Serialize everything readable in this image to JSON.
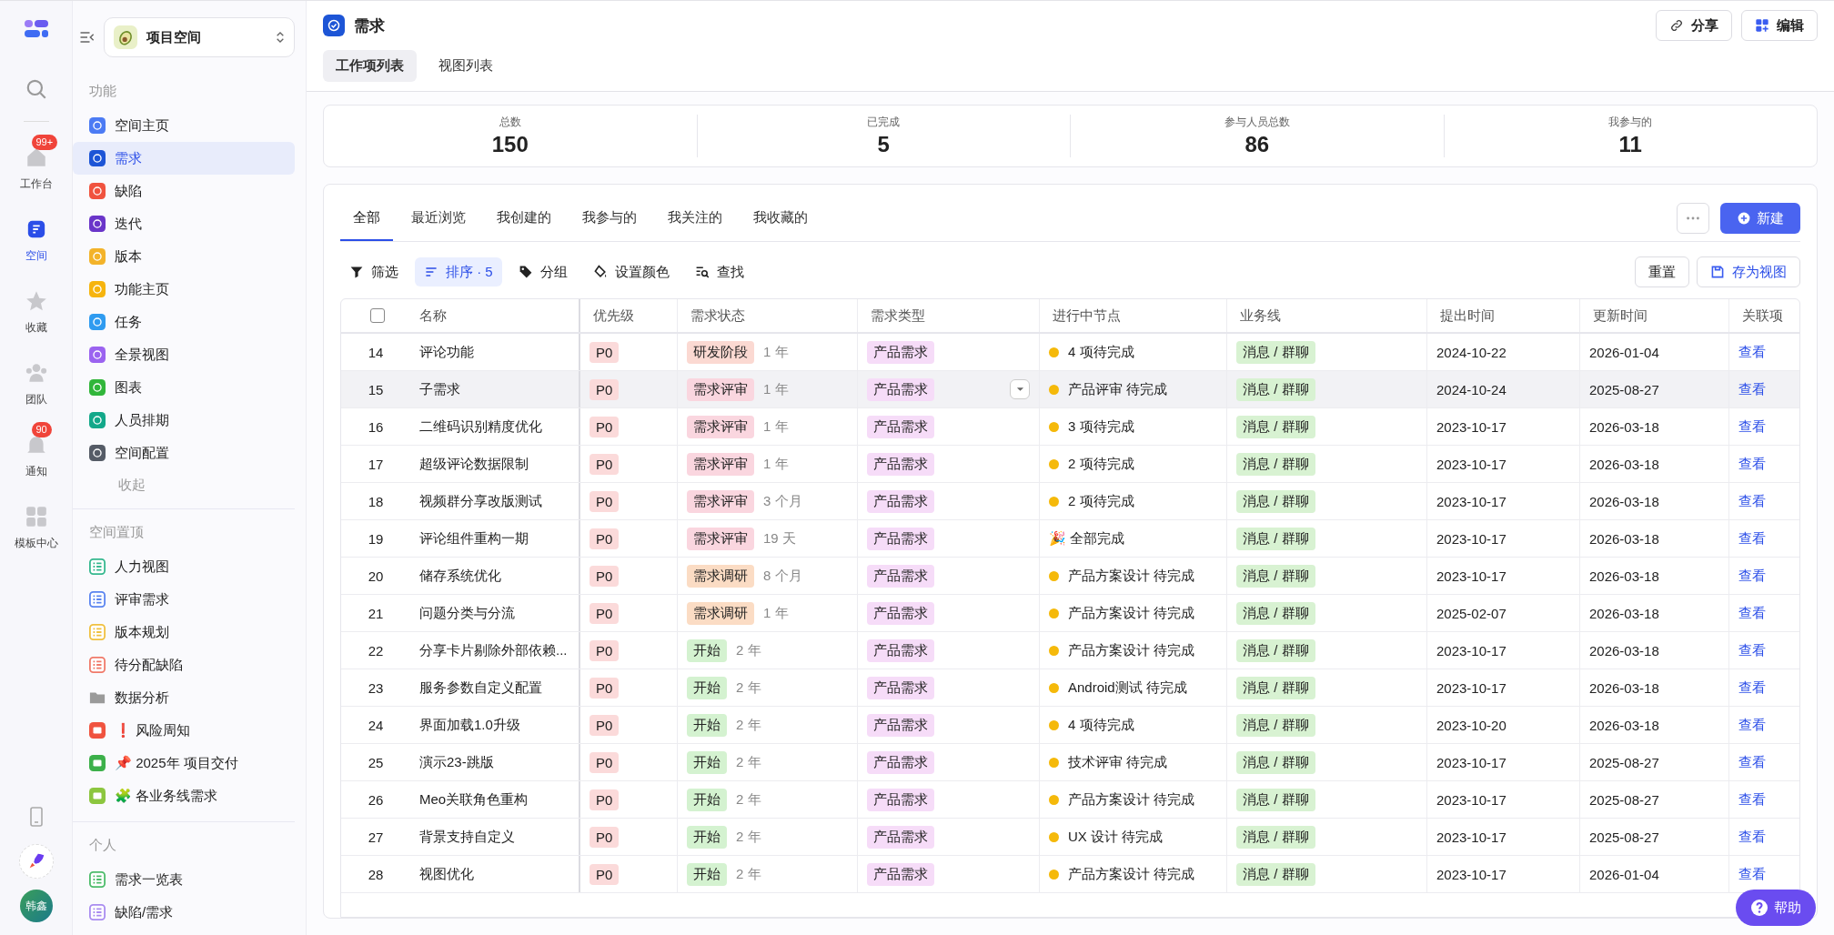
{
  "rail": {
    "items": [
      {
        "label": "工作台",
        "kind": "home",
        "badge": "99+",
        "selected": false
      },
      {
        "label": "空间",
        "kind": "space",
        "selected": true
      },
      {
        "label": "收藏",
        "kind": "star",
        "selected": false
      },
      {
        "label": "团队",
        "kind": "team",
        "selected": false
      },
      {
        "label": "通知",
        "kind": "bell",
        "badge": "90",
        "selected": false
      },
      {
        "label": "模板中心",
        "kind": "grid",
        "selected": false
      }
    ],
    "avatar": "韩鑫"
  },
  "sidebar": {
    "space": "项目空间",
    "sections": [
      {
        "title": "功能",
        "items": [
          {
            "label": "空间主页",
            "color": "#4c7bf4",
            "selected": false
          },
          {
            "label": "需求",
            "color": "#1d55d6",
            "selected": true
          },
          {
            "label": "缺陷",
            "color": "#f0533f",
            "selected": false
          },
          {
            "label": "迭代",
            "color": "#6a35c9",
            "selected": false
          },
          {
            "label": "版本",
            "color": "#f3b32a",
            "selected": false
          },
          {
            "label": "功能主页",
            "color": "#f6b40e",
            "selected": false
          },
          {
            "label": "任务",
            "color": "#2f9bf0",
            "selected": false
          },
          {
            "label": "全景视图",
            "color": "#9b63f0",
            "selected": false
          },
          {
            "label": "图表",
            "color": "#31b63a",
            "selected": false
          },
          {
            "label": "人员排期",
            "color": "#13a88a",
            "selected": false
          },
          {
            "label": "空间配置",
            "color": "#555b66",
            "selected": false
          }
        ],
        "more": "收起"
      },
      {
        "title": "空间置顶",
        "items": [
          {
            "label": "人力视图",
            "kind": "list",
            "color": "#35b88f",
            "selected": false
          },
          {
            "label": "评审需求",
            "kind": "list",
            "color": "#5a84f0",
            "selected": false
          },
          {
            "label": "版本规划",
            "kind": "list",
            "color": "#f0c040",
            "selected": false
          },
          {
            "label": "待分配缺陷",
            "kind": "list",
            "color": "#f07a6a",
            "selected": false
          },
          {
            "label": "数据分析",
            "kind": "folder",
            "color": "#9a9a9a",
            "selected": false
          },
          {
            "label": "❗ 风险周知",
            "kind": "board",
            "color": "#f0533f",
            "selected": false
          },
          {
            "label": "📌 2025年 项目交付",
            "kind": "board",
            "color": "#3cb04a",
            "selected": false
          },
          {
            "label": "🧩 各业务线需求",
            "kind": "board",
            "color": "#8cc63f",
            "selected": false
          }
        ]
      },
      {
        "title": "个人",
        "items": [
          {
            "label": "需求一览表",
            "kind": "list",
            "color": "#4cbc6a",
            "selected": false
          },
          {
            "label": "缺陷/需求",
            "kind": "list",
            "color": "#a98cf0",
            "selected": false
          }
        ]
      }
    ]
  },
  "header": {
    "title": "需求",
    "tabs": [
      {
        "label": "工作项列表",
        "selected": true
      },
      {
        "label": "视图列表",
        "selected": false
      }
    ],
    "buttons": [
      {
        "label": "分享",
        "kind": "share"
      },
      {
        "label": "编辑",
        "kind": "edit"
      }
    ]
  },
  "stats": [
    {
      "label": "总数",
      "value": "150"
    },
    {
      "label": "已完成",
      "value": "5"
    },
    {
      "label": "参与人员总数",
      "value": "86"
    },
    {
      "label": "我参与的",
      "value": "11"
    }
  ],
  "view_tabs": [
    {
      "label": "全部",
      "selected": true
    },
    {
      "label": "最近浏览",
      "selected": false
    },
    {
      "label": "我创建的",
      "selected": false
    },
    {
      "label": "我参与的",
      "selected": false
    },
    {
      "label": "我关注的",
      "selected": false
    },
    {
      "label": "我收藏的",
      "selected": false
    }
  ],
  "new_button": "新建",
  "toolbar": [
    {
      "label": "筛选",
      "kind": "filter",
      "selected": false
    },
    {
      "label": "排序 · 5",
      "kind": "sort",
      "selected": true
    },
    {
      "label": "分组",
      "kind": "tag",
      "selected": false
    },
    {
      "label": "设置颜色",
      "kind": "paint",
      "selected": false
    },
    {
      "label": "查找",
      "kind": "find",
      "selected": false
    }
  ],
  "toolbar_right": [
    {
      "label": "重置",
      "kind": "reset"
    },
    {
      "label": "存为视图",
      "kind": "save"
    }
  ],
  "table": {
    "header_checked": false,
    "columns": [
      "名称",
      "优先级",
      "需求状态",
      "需求类型",
      "进行中节点",
      "业务线",
      "提出时间",
      "更新时间",
      "关联项"
    ],
    "rows": [
      {
        "num": "14",
        "name": "评论功能",
        "priority": "P0",
        "status": "研发阶段",
        "color": "#fbd9d2",
        "age": "1 年",
        "type": "产品需求",
        "node": "4 项待完成",
        "dot": true,
        "biz": "消息 / 群聊",
        "submitted": "2024-10-22",
        "updated": "2026-01-04",
        "link": "查看",
        "hovered": false
      },
      {
        "num": "15",
        "name": "子需求",
        "priority": "P0",
        "status": "需求评审",
        "color": "#fad6df",
        "age": "1 年",
        "type": "产品需求",
        "node": "产品评审 待完成",
        "dot": true,
        "biz": "消息 / 群聊",
        "submitted": "2024-10-24",
        "updated": "2025-08-27",
        "link": "查看",
        "hovered": true
      },
      {
        "num": "16",
        "name": "二维码识别精度优化",
        "priority": "P0",
        "status": "需求评审",
        "color": "#fad6df",
        "age": "1 年",
        "type": "产品需求",
        "node": "3 项待完成",
        "dot": true,
        "biz": "消息 / 群聊",
        "submitted": "2023-10-17",
        "updated": "2026-03-18",
        "link": "查看",
        "hovered": false
      },
      {
        "num": "17",
        "name": "超级评论数据限制",
        "priority": "P0",
        "status": "需求评审",
        "color": "#fad6df",
        "age": "1 年",
        "type": "产品需求",
        "node": "2 项待完成",
        "dot": true,
        "biz": "消息 / 群聊",
        "submitted": "2023-10-17",
        "updated": "2026-03-18",
        "link": "查看",
        "hovered": false
      },
      {
        "num": "18",
        "name": "视频群分享改版测试",
        "priority": "P0",
        "status": "需求评审",
        "color": "#fad6df",
        "age": "3 个月",
        "type": "产品需求",
        "node": "2 项待完成",
        "dot": true,
        "biz": "消息 / 群聊",
        "submitted": "2023-10-17",
        "updated": "2026-03-18",
        "link": "查看",
        "hovered": false
      },
      {
        "num": "19",
        "name": "评论组件重构一期",
        "priority": "P0",
        "status": "需求评审",
        "color": "#fad6df",
        "age": "19 天",
        "type": "产品需求",
        "node": "🎉 全部完成",
        "dot": false,
        "biz": "消息 / 群聊",
        "submitted": "2023-10-17",
        "updated": "2026-03-18",
        "link": "查看",
        "hovered": false
      },
      {
        "num": "20",
        "name": "储存系统优化",
        "priority": "P0",
        "status": "需求调研",
        "color": "#fbdcc4",
        "age": "8 个月",
        "type": "产品需求",
        "node": "产品方案设计 待完成",
        "dot": true,
        "biz": "消息 / 群聊",
        "submitted": "2023-10-17",
        "updated": "2026-03-18",
        "link": "查看",
        "hovered": false
      },
      {
        "num": "21",
        "name": "问题分类与分流",
        "priority": "P0",
        "status": "需求调研",
        "color": "#fbdcc4",
        "age": "1 年",
        "type": "产品需求",
        "node": "产品方案设计 待完成",
        "dot": true,
        "biz": "消息 / 群聊",
        "submitted": "2025-02-07",
        "updated": "2026-03-18",
        "link": "查看",
        "hovered": false
      },
      {
        "num": "22",
        "name": "分享卡片剔除外部依赖...",
        "priority": "P0",
        "status": "开始",
        "color": "#d4f2d0",
        "age": "2 年",
        "type": "产品需求",
        "node": "产品方案设计 待完成",
        "dot": true,
        "biz": "消息 / 群聊",
        "submitted": "2023-10-17",
        "updated": "2026-03-18",
        "link": "查看",
        "hovered": false
      },
      {
        "num": "23",
        "name": "服务参数自定义配置",
        "priority": "P0",
        "status": "开始",
        "color": "#d4f2d0",
        "age": "2 年",
        "type": "产品需求",
        "node": "Android测试 待完成",
        "dot": true,
        "biz": "消息 / 群聊",
        "submitted": "2023-10-17",
        "updated": "2026-03-18",
        "link": "查看",
        "hovered": false
      },
      {
        "num": "24",
        "name": "界面加载1.0升级",
        "priority": "P0",
        "status": "开始",
        "color": "#d4f2d0",
        "age": "2 年",
        "type": "产品需求",
        "node": "4 项待完成",
        "dot": true,
        "biz": "消息 / 群聊",
        "submitted": "2023-10-20",
        "updated": "2026-03-18",
        "link": "查看",
        "hovered": false
      },
      {
        "num": "25",
        "name": "演示23-跳版",
        "priority": "P0",
        "status": "开始",
        "color": "#d4f2d0",
        "age": "2 年",
        "type": "产品需求",
        "node": "技术评审 待完成",
        "dot": true,
        "biz": "消息 / 群聊",
        "submitted": "2023-10-17",
        "updated": "2025-08-27",
        "link": "查看",
        "hovered": false
      },
      {
        "num": "26",
        "name": "Meo关联角色重构",
        "priority": "P0",
        "status": "开始",
        "color": "#d4f2d0",
        "age": "2 年",
        "type": "产品需求",
        "node": "产品方案设计 待完成",
        "dot": true,
        "biz": "消息 / 群聊",
        "submitted": "2023-10-17",
        "updated": "2025-08-27",
        "link": "查看",
        "hovered": false
      },
      {
        "num": "27",
        "name": "背景支持自定义",
        "priority": "P0",
        "status": "开始",
        "color": "#d4f2d0",
        "age": "2 年",
        "type": "产品需求",
        "node": "UX 设计 待完成",
        "dot": true,
        "biz": "消息 / 群聊",
        "submitted": "2023-10-17",
        "updated": "2025-08-27",
        "link": "查看",
        "hovered": false
      },
      {
        "num": "28",
        "name": "视图优化",
        "priority": "P0",
        "status": "开始",
        "color": "#d4f2d0",
        "age": "2 年",
        "type": "产品需求",
        "node": "产品方案设计 待完成",
        "dot": true,
        "biz": "消息 / 群聊",
        "submitted": "2023-10-17",
        "updated": "2026-01-04",
        "link": "查看",
        "hovered": false
      }
    ]
  },
  "help_button": "帮助"
}
